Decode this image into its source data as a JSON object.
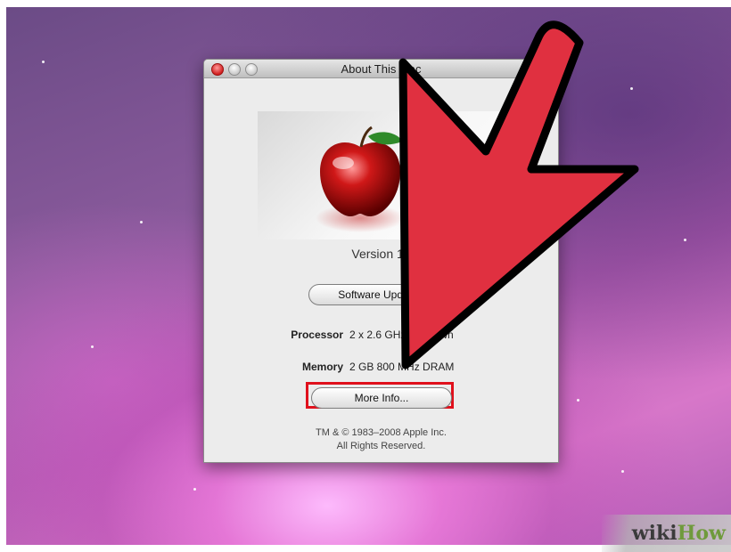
{
  "window": {
    "title": "About This Mac",
    "version": "Version 10",
    "software_update_label": "Software Update...",
    "processor_label": "Processor",
    "processor_value": "2 x 2.6 GHz Unknown",
    "memory_label": "Memory",
    "memory_value": "2 GB 800 MHz DRAM",
    "more_info_label": "More Info...",
    "copyright_line1": "TM & © 1983–2008 Apple Inc.",
    "copyright_line2": "All Rights Reserved."
  },
  "overlay": {
    "arrow_color": "#e03040",
    "highlight_color": "#e0101c"
  },
  "branding": {
    "wiki": "wiki",
    "how": "How"
  },
  "icons": [
    "close-icon",
    "minimize-icon",
    "zoom-icon",
    "apple-logo"
  ]
}
